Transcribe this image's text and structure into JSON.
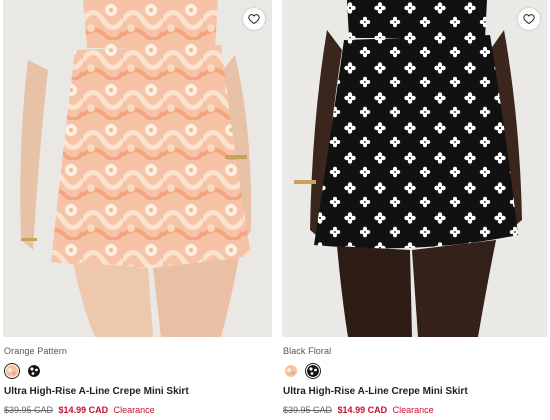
{
  "products": [
    {
      "color_name": "Orange Pattern",
      "title": "Ultra High-Rise A-Line Crepe Mini Skirt",
      "original_price": "$39.95 CAD",
      "sale_price": "$14.99 CAD",
      "badge": "Clearance",
      "swatches": [
        {
          "name": "orange-pattern",
          "selected": true
        },
        {
          "name": "black-floral",
          "selected": false
        }
      ]
    },
    {
      "color_name": "Black Floral",
      "title": "Ultra High-Rise A-Line Crepe Mini Skirt",
      "original_price": "$39.95 CAD",
      "sale_price": "$14.99 CAD",
      "badge": "Clearance",
      "swatches": [
        {
          "name": "orange-pattern",
          "selected": false
        },
        {
          "name": "black-floral",
          "selected": true
        }
      ]
    }
  ],
  "colors": {
    "sale": "#c8102e",
    "text": "#222222",
    "muted": "#666666"
  },
  "icons": {
    "wishlist": "heart-outline-icon"
  }
}
